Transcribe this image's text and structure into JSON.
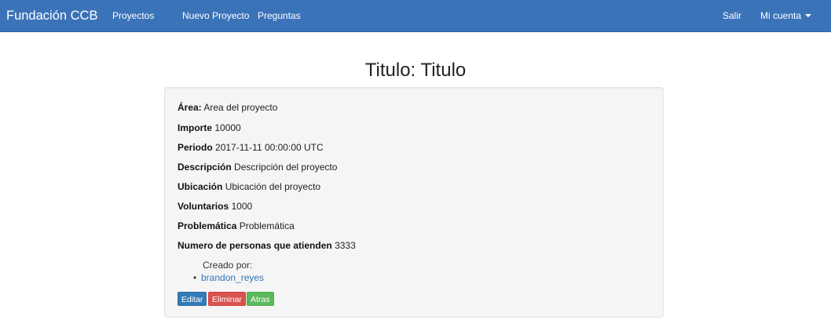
{
  "navbar": {
    "brand": "Fundación CCB",
    "links": [
      "Proyectos",
      "Nuevo Proyecto",
      "Preguntas"
    ],
    "logout": "Salir",
    "account": "Mi cuenta",
    "account_icon": "caret-down-icon",
    "color": "#3b73b9"
  },
  "page": {
    "title": "Titulo: Titulo"
  },
  "details": [
    {
      "label": "Área:",
      "value": "Area del proyecto"
    },
    {
      "label": "Importe",
      "value": "10000"
    },
    {
      "label": "Periodo",
      "value": "2017-11-11 00:00:00 UTC"
    },
    {
      "label": "Descripción",
      "value": "Descripción del proyecto"
    },
    {
      "label": "Ubicación",
      "value": "Ubicación del proyecto"
    },
    {
      "label": "Voluntarios",
      "value": "1000"
    },
    {
      "label": "Problemática",
      "value": "Problemática"
    },
    {
      "label": "Numero de personas que atienden",
      "value": "3333"
    }
  ],
  "creator": {
    "heading": "Creado por:",
    "user": "brandon_reyes"
  },
  "actions": {
    "edit": "Editar",
    "delete": "Eliminar",
    "back": "Atras"
  }
}
